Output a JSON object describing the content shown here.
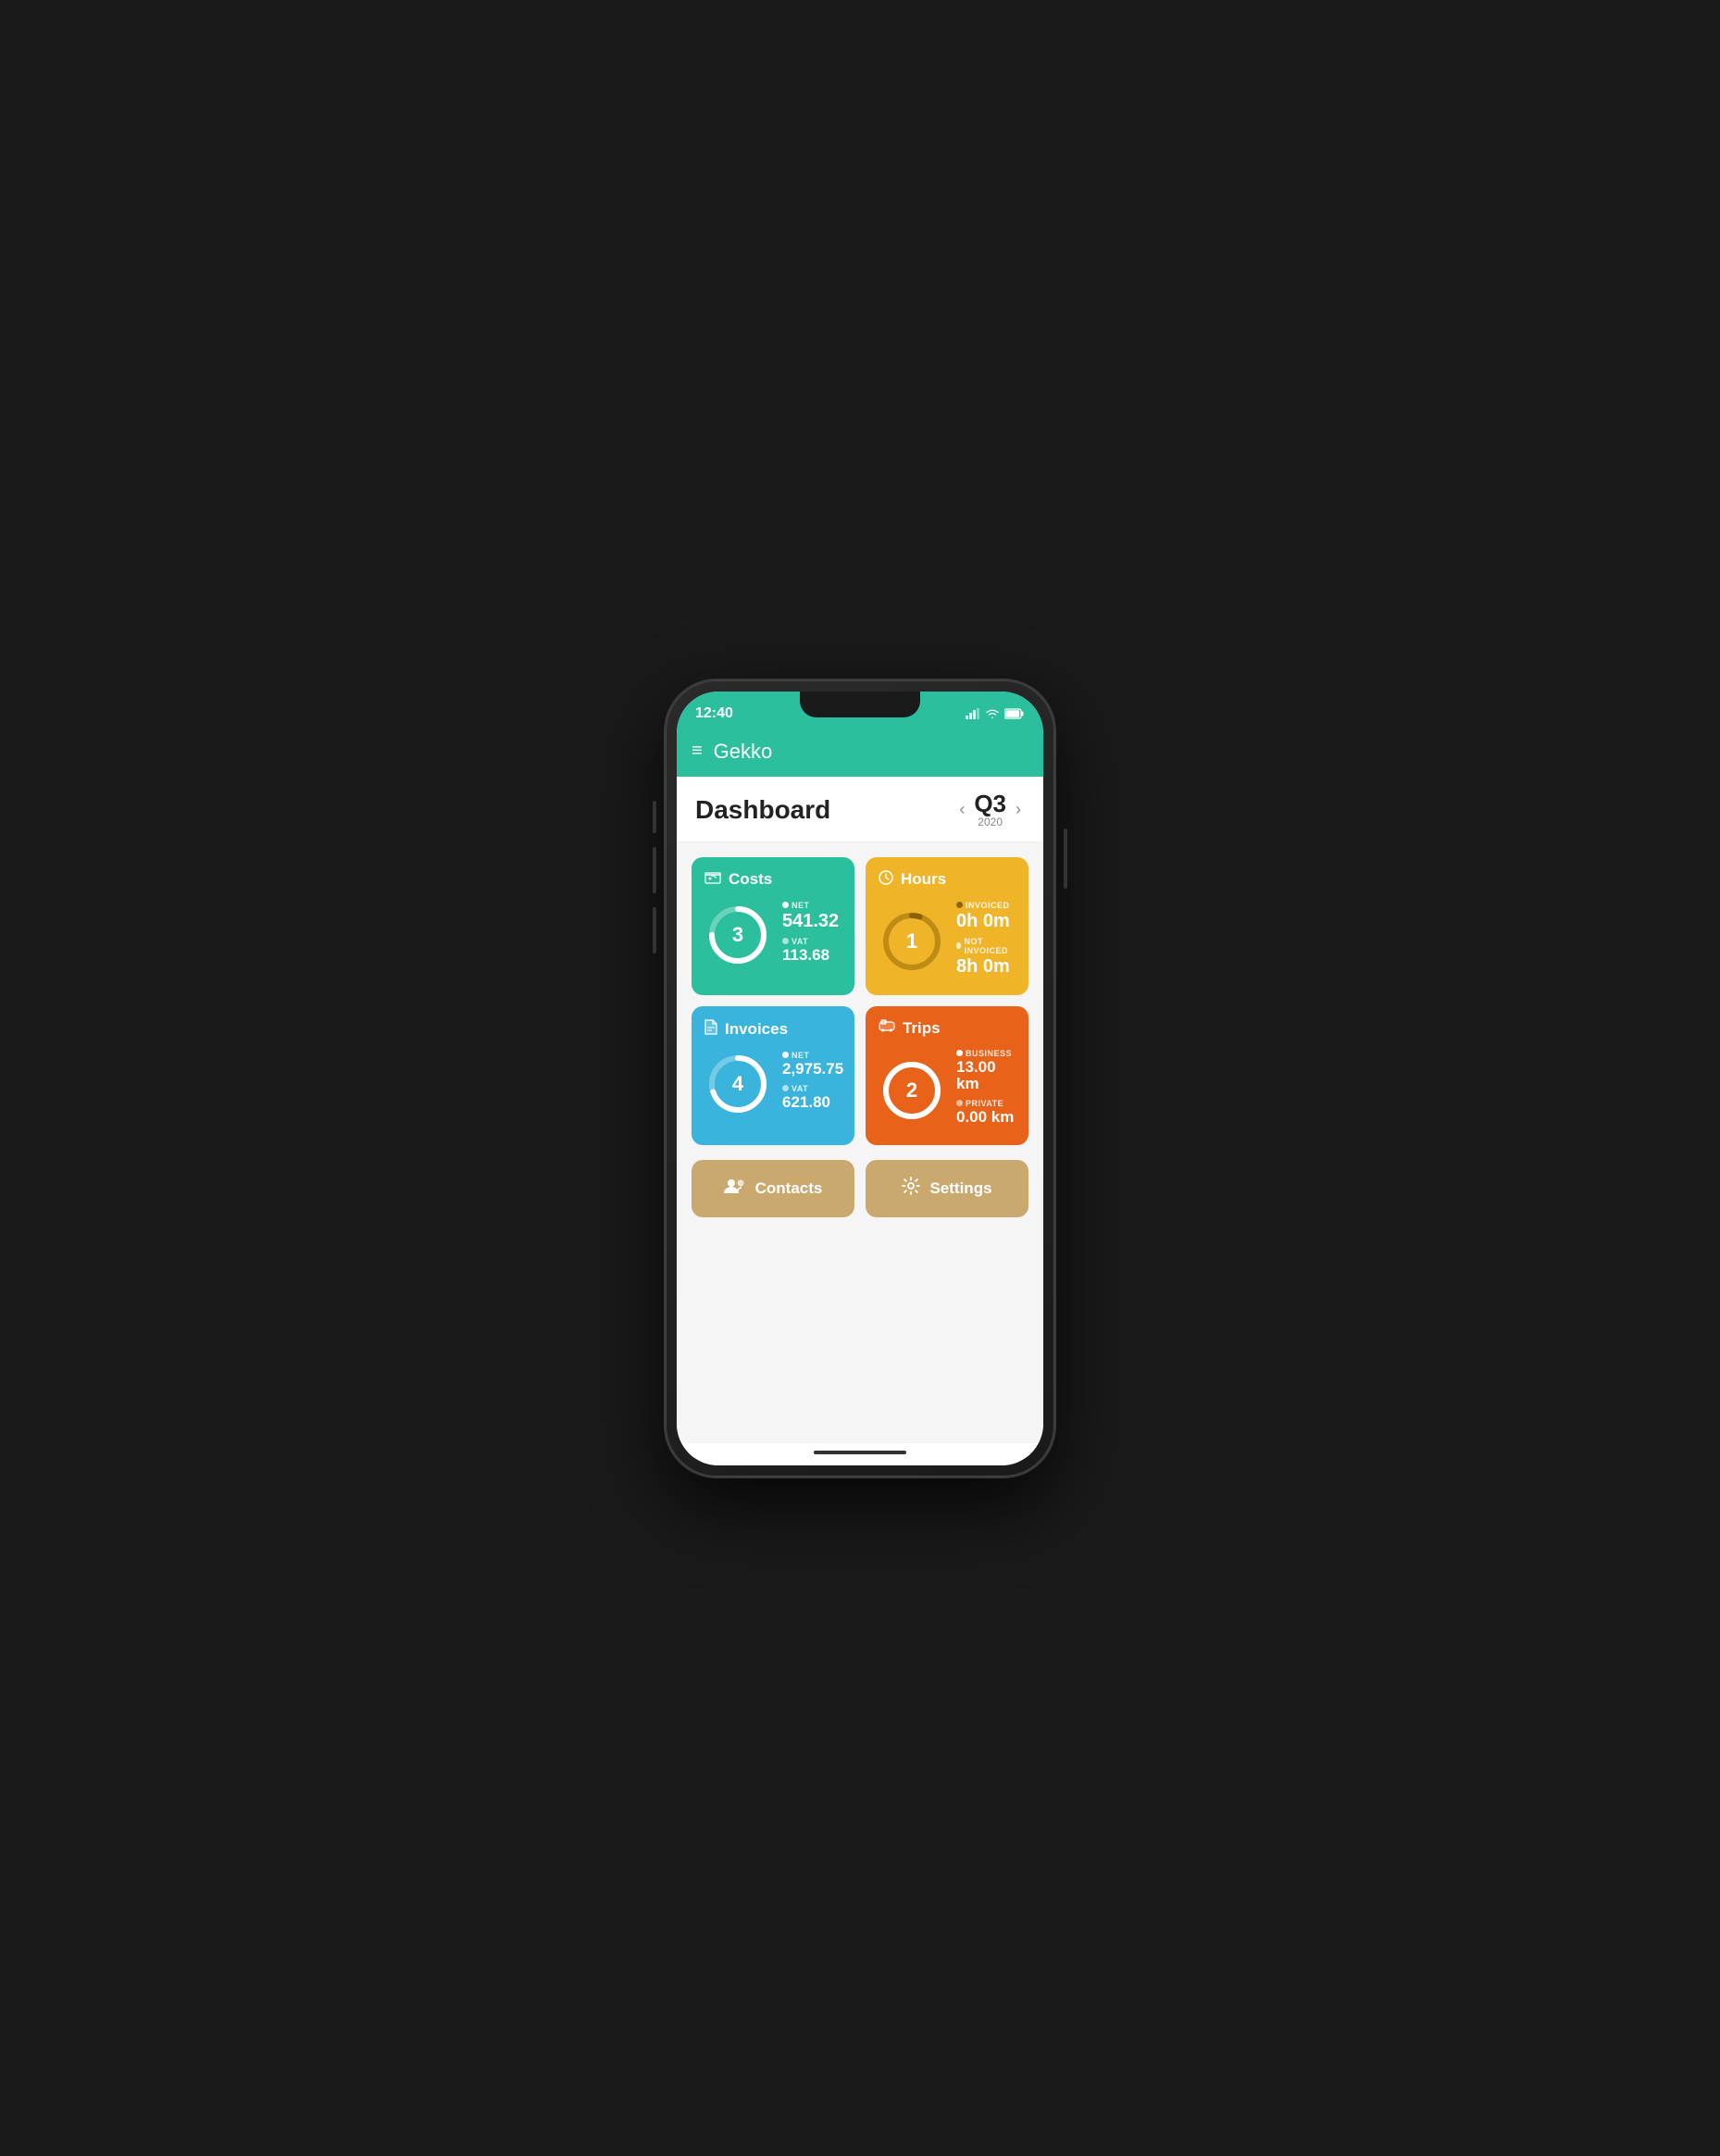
{
  "status": {
    "time": "12:40",
    "wifi_icon": "wifi",
    "battery_icon": "battery"
  },
  "header": {
    "menu_icon": "≡",
    "app_name": "Gekko"
  },
  "dashboard": {
    "title": "Dashboard",
    "period": {
      "quarter": "Q3",
      "year": "2020",
      "prev_label": "‹",
      "next_label": "›"
    }
  },
  "cards": {
    "costs": {
      "name": "Costs",
      "count": "3",
      "net_label": "NET",
      "net_value": "541.32",
      "vat_label": "VAT",
      "vat_value": "113.68",
      "color": "#2bbf9e",
      "donut_pct": 75
    },
    "hours": {
      "name": "Hours",
      "count": "1",
      "invoiced_label": "INVOICED",
      "invoiced_value": "0h 0m",
      "not_invoiced_label": "NOT INVOICED",
      "not_invoiced_value": "8h 0m",
      "color": "#f0b429",
      "donut_pct": 5
    },
    "invoices": {
      "name": "Invoices",
      "count": "4",
      "net_label": "NET",
      "net_value": "2,975.75",
      "vat_label": "VAT",
      "vat_value": "621.80",
      "color": "#3ab4dc",
      "donut_pct": 70
    },
    "trips": {
      "name": "Trips",
      "count": "2",
      "business_label": "BUSINESS",
      "business_value": "13.00 km",
      "private_label": "PRIVATE",
      "private_value": "0.00 km",
      "color": "#e8621a",
      "donut_pct": 100
    }
  },
  "bottom_buttons": {
    "contacts": {
      "label": "Contacts",
      "icon": "👥"
    },
    "settings": {
      "label": "Settings",
      "icon": "⚙"
    }
  }
}
